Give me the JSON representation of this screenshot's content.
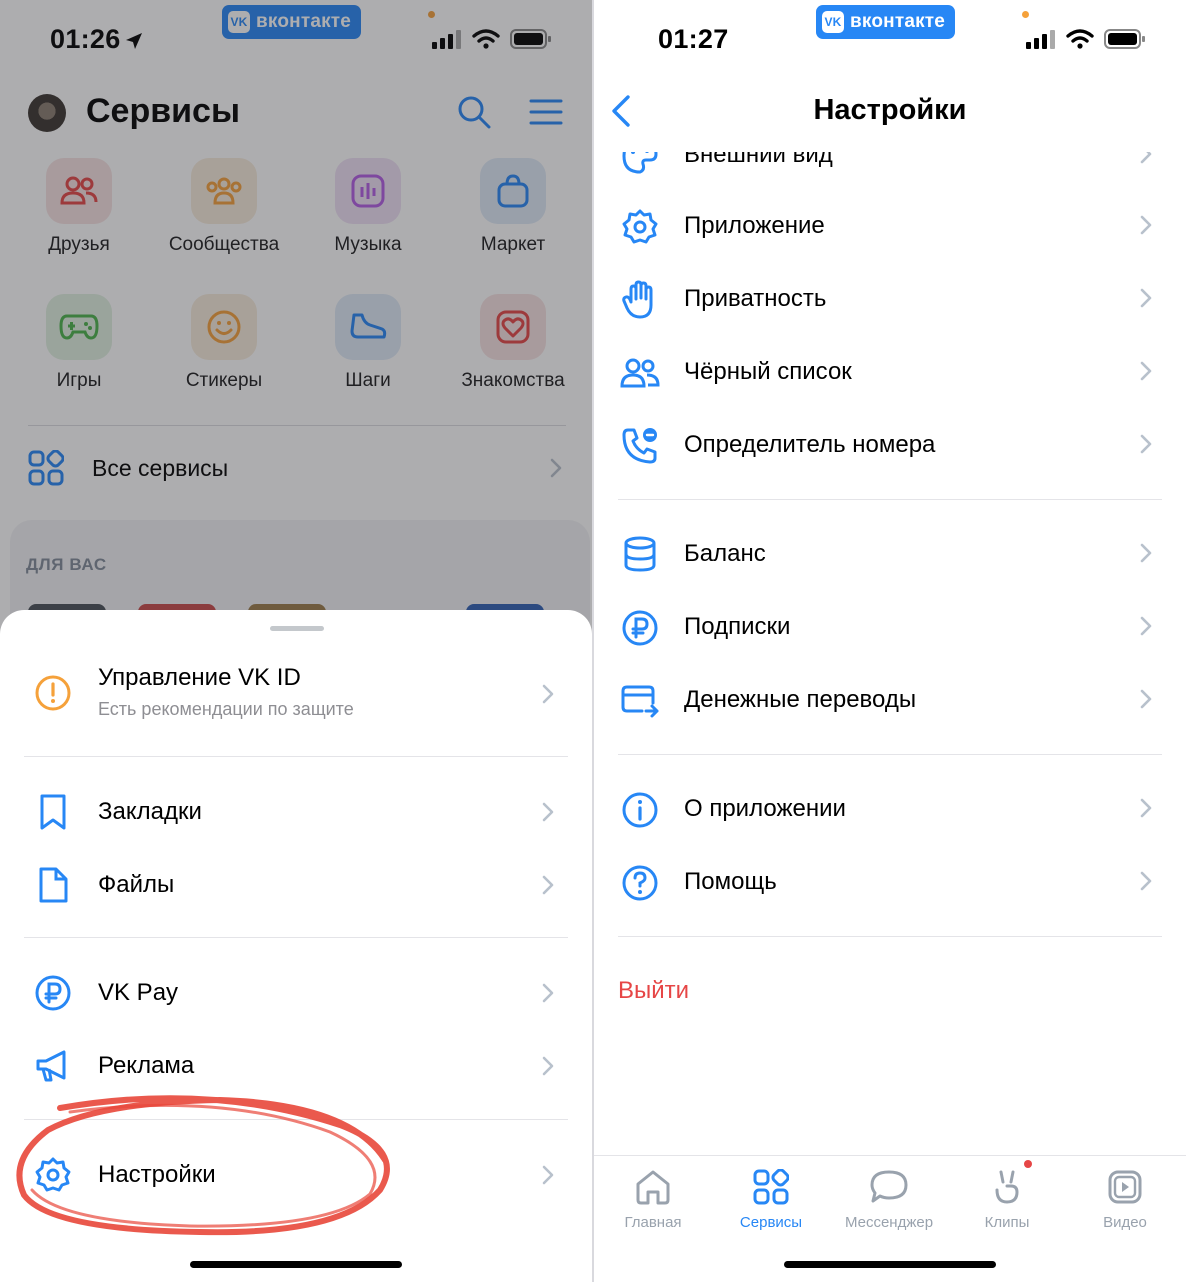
{
  "brand": {
    "vk_badge": "вконтакте",
    "vk_mark": "VK"
  },
  "colors": {
    "accent": "#2787f5",
    "danger": "#e64646",
    "warning": "#f5a13a",
    "secondary_text": "#818c99"
  },
  "left": {
    "status_time": "01:26",
    "header": {
      "title": "Сервисы"
    },
    "services": [
      {
        "label": "Друзья",
        "icon": "friends-icon",
        "color": "#e64646"
      },
      {
        "label": "Сообщества",
        "icon": "communities-icon",
        "color": "#f5a13a"
      },
      {
        "label": "Музыка",
        "icon": "music-icon",
        "color": "#b45ce6"
      },
      {
        "label": "Маркет",
        "icon": "market-icon",
        "color": "#2787f5"
      },
      {
        "label": "Игры",
        "icon": "games-icon",
        "color": "#4bb34b"
      },
      {
        "label": "Стикеры",
        "icon": "stickers-icon",
        "color": "#f5a13a"
      },
      {
        "label": "Шаги",
        "icon": "steps-icon",
        "color": "#2787f5"
      },
      {
        "label": "Знакомства",
        "icon": "dating-icon",
        "color": "#e64646"
      }
    ],
    "all_services": "Все сервисы",
    "for_you": "ДЛЯ ВАС",
    "sheet": {
      "vkid_title": "Управление VK ID",
      "vkid_subtitle": "Есть рекомендации по защите",
      "items": [
        {
          "label": "Закладки",
          "icon": "bookmark-icon"
        },
        {
          "label": "Файлы",
          "icon": "file-icon"
        },
        {
          "label": "VK Pay",
          "icon": "ruble-icon"
        },
        {
          "label": "Реклама",
          "icon": "megaphone-icon"
        },
        {
          "label": "Настройки",
          "icon": "gear-icon"
        }
      ]
    }
  },
  "right": {
    "status_time": "01:27",
    "header": {
      "title": "Настройки"
    },
    "group1": [
      {
        "label": "Внешний вид",
        "icon": "palette-icon"
      },
      {
        "label": "Приложение",
        "icon": "gear-icon"
      },
      {
        "label": "Приватность",
        "icon": "hand-icon"
      },
      {
        "label": "Чёрный список",
        "icon": "users-icon"
      },
      {
        "label": "Определитель номера",
        "icon": "phone-icon"
      }
    ],
    "group2": [
      {
        "label": "Баланс",
        "icon": "coins-icon"
      },
      {
        "label": "Подписки",
        "icon": "ruble-icon"
      },
      {
        "label": "Денежные переводы",
        "icon": "card-transfer-icon"
      }
    ],
    "group3": [
      {
        "label": "О приложении",
        "icon": "info-icon"
      },
      {
        "label": "Помощь",
        "icon": "help-icon"
      }
    ],
    "logout": "Выйти",
    "tabs": [
      {
        "label": "Главная",
        "icon": "home-icon",
        "active": false
      },
      {
        "label": "Сервисы",
        "icon": "services-icon",
        "active": true
      },
      {
        "label": "Мессенджер",
        "icon": "messenger-icon",
        "active": false
      },
      {
        "label": "Клипы",
        "icon": "clips-icon",
        "active": false
      },
      {
        "label": "Видео",
        "icon": "video-icon",
        "active": false
      }
    ]
  }
}
